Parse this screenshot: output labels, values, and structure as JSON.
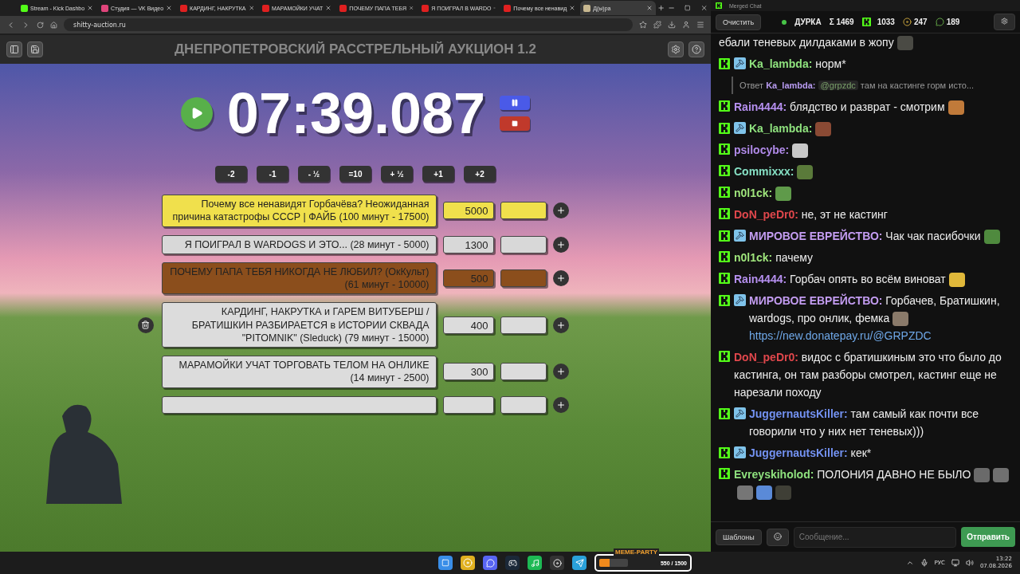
{
  "browser": {
    "tabs": [
      {
        "title": "Stream - Kick Dashbo",
        "kind": "kick",
        "selected": false
      },
      {
        "title": "Студия — VK Видео",
        "kind": "vk",
        "selected": false
      },
      {
        "title": "КАРДИНГ, НАКРУТКА",
        "kind": "youtube",
        "selected": false
      },
      {
        "title": "МАРАМОЙКИ УЧАТ",
        "kind": "youtube",
        "selected": false
      },
      {
        "title": "ПОЧЕМУ ПАПА ТЕБЯ",
        "kind": "youtube",
        "selected": false
      },
      {
        "title": "Я ПОИГРАЛ В WARDO",
        "kind": "youtube",
        "selected": false
      },
      {
        "title": "Почему все ненавид",
        "kind": "youtube",
        "selected": false
      },
      {
        "title": "Д(ы)ра",
        "kind": "page",
        "selected": true
      }
    ],
    "url": "shitty-auction.ru"
  },
  "app": {
    "title": "ДНЕПРОПЕТРОВСКИЙ РАССТРЕЛЬНЫЙ АУКЦИОН 1.2",
    "timer": "07:39.087",
    "adjust_buttons": [
      "-2",
      "-1",
      "- ½",
      "=10",
      "+ ½",
      "+1",
      "+2"
    ],
    "lots": [
      {
        "kind": "lot",
        "title": "Почему все ненавидят Горбачёва? Неожиданная причина катастрофы СССР | ФАЙБ (100 минут - 17500)",
        "amount": "5000",
        "color": "#f0e04c",
        "hovered": false
      },
      {
        "kind": "lot",
        "title": "Я ПОИГРАЛ В WARDOGS И ЭТО... (28 минут - 5000)",
        "amount": "1300",
        "color": "#d8d8d8",
        "hovered": false
      },
      {
        "kind": "lot",
        "title": "ПОЧЕМУ ПАПА ТЕБЯ НИКОГДА НЕ ЛЮБИЛ? (ОкКульт) (61 минут - 10000)",
        "amount": "500",
        "color": "#8b4e1c",
        "hovered": false
      },
      {
        "kind": "lot",
        "title": "КАРДИНГ, НАКРУТКА и ГАРЕМ ВИТУБЕРШ / БРАТИШКИН РАЗБИРАЕТСЯ в ИСТОРИИ СКВАДА \"PITOMNIK\" (Sleduck) (79 минут - 15000)",
        "amount": "400",
        "color": "#dcdcdc",
        "hovered": true
      },
      {
        "kind": "lot",
        "title": "МАРАМОЙКИ УЧАТ ТОРГОВАТЬ ТЕЛОМ НА ОНЛИКЕ (14 минут - 2500)",
        "amount": "300",
        "color": "#dcdcdc",
        "hovered": false
      },
      {
        "kind": "empty",
        "color": "#dcdcdc",
        "hovered": false
      }
    ]
  },
  "chat": {
    "window_title": "Merged Chat",
    "clear_button": "Очистить",
    "channel": "ДУРКА",
    "stats": [
      {
        "kind": "sum",
        "value": "Σ 1469"
      },
      {
        "kind": "kick",
        "value": "1033"
      },
      {
        "kind": "bird",
        "value": "247"
      },
      {
        "kind": "frog",
        "value": "189"
      }
    ],
    "messages": [
      {
        "kind": "continuation",
        "text": "ебали теневых дилдаками в жопу",
        "emotes": [
          {
            "color": "#4a4a44"
          }
        ]
      },
      {
        "kind": "message",
        "user": "Ka_lambda:",
        "color": "#8fe27e",
        "mod": true,
        "text": "норм*"
      },
      {
        "kind": "reply",
        "label": "Ответ",
        "user": "Ka_lambda:",
        "color": "#b99cf2",
        "mention": "@grpzdc",
        "text": "там на кастинге горм исто..."
      },
      {
        "kind": "message",
        "user": "Rain4444:",
        "color": "#b690f0",
        "mod": false,
        "text": "блядство и разврат - смотрим",
        "emotes": [
          {
            "color": "#c07a3a"
          }
        ]
      },
      {
        "kind": "message",
        "user": "Ka_lambda:",
        "color": "#8fe27e",
        "mod": true,
        "emotes": [
          {
            "color": "#8a4a34"
          }
        ]
      },
      {
        "kind": "message",
        "user": "psilocybe:",
        "color": "#b08ae8",
        "mod": false,
        "emotes": [
          {
            "color": "#c8c8c8"
          }
        ]
      },
      {
        "kind": "message",
        "user": "Commixxx:",
        "color": "#86e0c4",
        "mod": false,
        "emotes": [
          {
            "color": "#5a7a3a"
          }
        ]
      },
      {
        "kind": "message",
        "user": "n0l1ck:",
        "color": "#9fe57c",
        "mod": false,
        "emotes": [
          {
            "color": "#5f9a4a"
          }
        ]
      },
      {
        "kind": "message",
        "user": "DoN_peDr0:",
        "color": "#e0474c",
        "mod": false,
        "text": "не, эт не кастинг"
      },
      {
        "kind": "message",
        "user": "МИРОВОЕ ЕВРЕЙСТВО:",
        "color": "#c49df2",
        "mod": true,
        "text": "Чак чак пасибочки",
        "emotes": [
          {
            "color": "#4f8a3e"
          }
        ]
      },
      {
        "kind": "message",
        "user": "n0l1ck:",
        "color": "#9fe57c",
        "mod": false,
        "text": "пачему"
      },
      {
        "kind": "message",
        "user": "Rain4444:",
        "color": "#b690f0",
        "mod": false,
        "text": "Горбач опять во всём виноват",
        "emotes": [
          {
            "color": "#e0b83a"
          }
        ]
      },
      {
        "kind": "message",
        "user": "МИРОВОЕ ЕВРЕЙСТВО:",
        "color": "#c49df2",
        "mod": true,
        "text": "Горбачев, Братишкин, wardogs, про онлик, фемка",
        "emotes": [
          {
            "color": "#8a7a6a"
          }
        ],
        "link": "https://new.donatepay.ru/@GRPZDC"
      },
      {
        "kind": "message",
        "user": "DoN_peDr0:",
        "color": "#e0474c",
        "mod": false,
        "text": "видос с братишкиным это что было до кастинга, он там разборы смотрел, кастинг еще не нарезали походу"
      },
      {
        "kind": "message",
        "user": "JuggernautsKiller:",
        "color": "#7392f2",
        "mod": true,
        "text": "там самый как почти все говорили что у них нет теневых)))"
      },
      {
        "kind": "message",
        "user": "JuggernautsKiller:",
        "color": "#7392f2",
        "mod": true,
        "text": "кек*"
      },
      {
        "kind": "message",
        "user": "Evreyskiholod:",
        "color": "#8fe27e",
        "mod": false,
        "text": "ПОЛОНИЯ ДАВНО НЕ БЫЛО",
        "emotes": [
          {
            "color": "#6a6a6a"
          },
          {
            "color": "#707070"
          },
          {
            "color": "#767676"
          },
          {
            "color": "#5a8ad8"
          },
          {
            "color": "#3f3f36"
          }
        ]
      }
    ],
    "templates_button": "Шаблоны",
    "input_placeholder": "Сообщение...",
    "send_button": "Отправить"
  },
  "taskbar": {
    "widget": {
      "title": "MEME-PARTY",
      "progress": "550 / 1500",
      "level": 0.37
    },
    "language": "РУС",
    "time": "13:22",
    "date": "07.08.2026"
  }
}
